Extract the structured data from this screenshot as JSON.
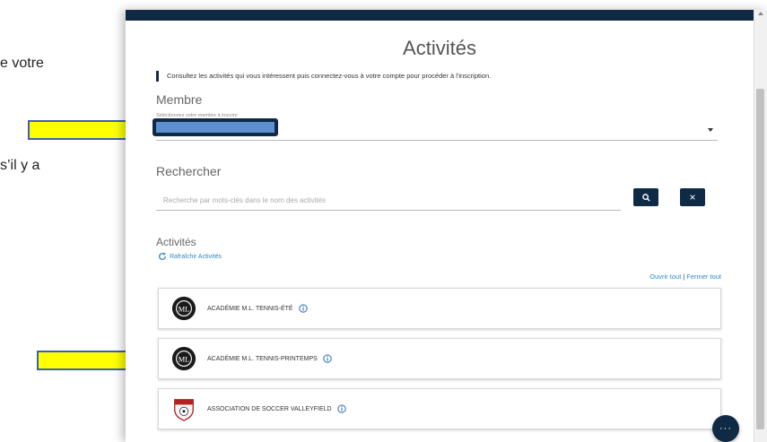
{
  "background_text": {
    "line1": "e votre",
    "line2": "s’il y a"
  },
  "app": {
    "title": "Activités",
    "notice": "Consultez les activités qui vous intéressent puis connectez-vous à votre compte pour procéder à l'inscription."
  },
  "membre": {
    "label": "Membre",
    "hint": "Sélectionnez votre membre à inscrire"
  },
  "search": {
    "label": "Rechercher",
    "placeholder": "Recherche par mots-clés dans le nom des activités"
  },
  "activities": {
    "label": "Activités",
    "refresh_label": "Rafraîchir Activités",
    "open_all": "Ouvrir tout",
    "separator": "|",
    "close_all": "Fermer tout",
    "items": [
      {
        "name": "ACADÉMIE M.L. TENNIS-ÉTÉ",
        "logo": "ml-logo"
      },
      {
        "name": "ACADÉMIE M.L. TENNIS-PRINTEMPS",
        "logo": "ml-logo"
      },
      {
        "name": "ASSOCIATION DE SOCCER VALLEYFIELD",
        "logo": "soccer-crest"
      }
    ]
  },
  "fab": {
    "label": "···"
  },
  "colors": {
    "brand_dark": "#0f2a44",
    "link": "#2d8ac7",
    "arrow_fill": "#ffff00",
    "arrow_stroke": "#3b62a8",
    "highlight": "#5e8fd0"
  }
}
